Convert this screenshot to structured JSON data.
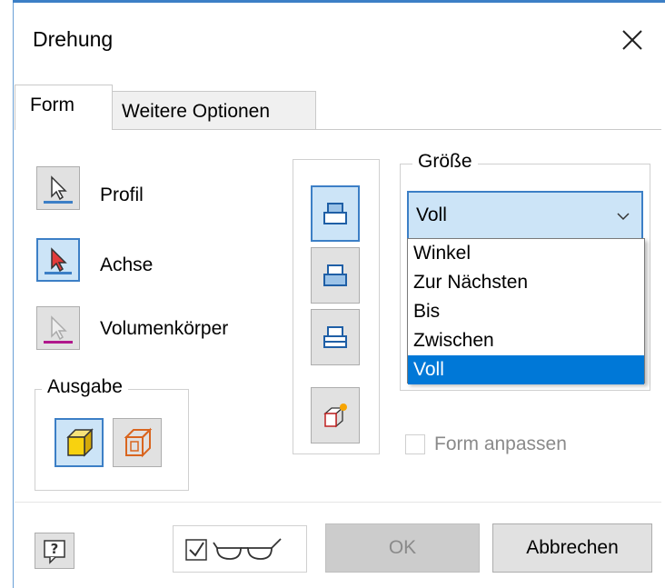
{
  "dialog": {
    "title": "Drehung",
    "tabs": [
      {
        "label": "Form",
        "active": true
      },
      {
        "label": "Weitere Optionen",
        "active": false
      }
    ]
  },
  "selectors": [
    {
      "label": "Profil",
      "active": false,
      "underline_color": "#3c7fc6",
      "icon": "cursor-arrow-icon"
    },
    {
      "label": "Achse",
      "active": true,
      "underline_color": "#3c7fc6",
      "icon": "cursor-arrow-red-icon"
    },
    {
      "label": "Volumenkörper",
      "active": false,
      "underline_color": "#b0188c",
      "icon": "cursor-arrow-disabled-icon"
    }
  ],
  "output_group": {
    "label": "Ausgabe",
    "buttons": [
      {
        "name": "solid-output",
        "active": true,
        "icon": "solid-cube-icon"
      },
      {
        "name": "surface-output",
        "active": false,
        "icon": "surface-cube-icon"
      }
    ]
  },
  "direction_buttons": [
    {
      "name": "direction-default",
      "active": true
    },
    {
      "name": "direction-flipped",
      "active": false
    },
    {
      "name": "direction-symmetric",
      "active": false
    },
    {
      "name": "direction-asymmetric",
      "active": false
    }
  ],
  "size_group": {
    "label": "Größe",
    "selected": "Voll",
    "options": [
      "Winkel",
      "Zur Nächsten",
      "Bis",
      "Zwischen",
      "Voll"
    ],
    "highlighted_option": "Voll"
  },
  "match_shape": {
    "label": "Form anpassen",
    "checked": false,
    "enabled": false
  },
  "footer": {
    "preview_checked": true,
    "ok_label": "OK",
    "ok_enabled": false,
    "cancel_label": "Abbrechen"
  },
  "colors": {
    "accent": "#3c7fc6",
    "selection": "#0078d7",
    "active_fill": "#cce4f7"
  }
}
